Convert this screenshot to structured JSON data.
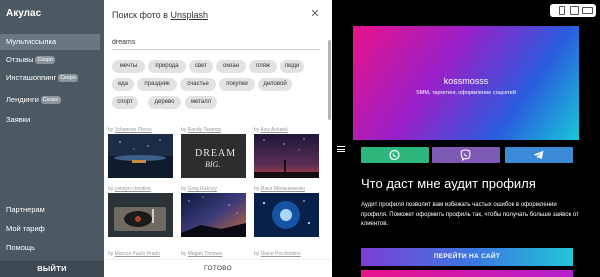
{
  "sidebar": {
    "brand": "Акулас",
    "items": [
      {
        "label": "Мультиссылка",
        "badge": ""
      },
      {
        "label": "Отзывы",
        "badge": "Скоро"
      },
      {
        "label": "Инсташоппинг",
        "badge": "Скоро"
      },
      {
        "label": "Лендинги",
        "badge": "Скоро"
      },
      {
        "label": "Заявки",
        "badge": ""
      }
    ],
    "bottom_items": [
      "Партнерам",
      "Мой тариф",
      "Помощь"
    ],
    "logout": "ВЫЙТИ"
  },
  "photo_search": {
    "title_prefix": "Поиск фото в ",
    "title_link": "Unsplash",
    "query": "dreams",
    "tags": [
      "мечты",
      "природа",
      "свет",
      "океан",
      "пляж",
      "люди",
      "еда",
      "праздник",
      "счастье",
      "покупки",
      "деловой",
      "спорт",
      "дерево",
      "металл"
    ],
    "credit_prefix": "by",
    "photos": [
      {
        "author": "Johannes Plenio",
        "subject": "night-lake-stars"
      },
      {
        "author": "Randy Tarampi",
        "subject": "dream-big-sign"
      },
      {
        "author": "Aziz Acharki",
        "subject": "starry-sky-figure"
      },
      {
        "author": "carolyn christine",
        "subject": "record-player"
      },
      {
        "author": "Greg Rakozy",
        "subject": "galaxy-sky"
      },
      {
        "author": "Илья Мельниченко",
        "subject": "night-sky-sparkles"
      },
      {
        "author": "Marcos Paulo Prado",
        "subject": ""
      },
      {
        "author": "Megan Thomas",
        "subject": ""
      },
      {
        "author": "Diane Picchiottino",
        "subject": ""
      }
    ],
    "done": "ГОТОВО"
  },
  "preview": {
    "profile_name": "kossmosss",
    "profile_sub": "SMM, таргетинг, оформление соцсетей",
    "messengers": [
      "whatsapp-icon",
      "viber-icon",
      "telegram-icon"
    ],
    "headline": "Что даст мне аудит профиля",
    "description": "Аудит профиля позволит вам избежать частых ошибок в оформлении профиля. Поможет оформить профиль так, чтобы получать больше заявок от клиентов.",
    "cta": "ПЕРЕЙТИ НА САЙТ"
  },
  "colors": {
    "sidebar_bg": "#4c5962",
    "sidebar_active": "#6b7780",
    "tag_bg": "#e2e2e2",
    "whatsapp": "#2eb67d",
    "viber": "#7d5bb5",
    "telegram": "#3a8ad6"
  }
}
